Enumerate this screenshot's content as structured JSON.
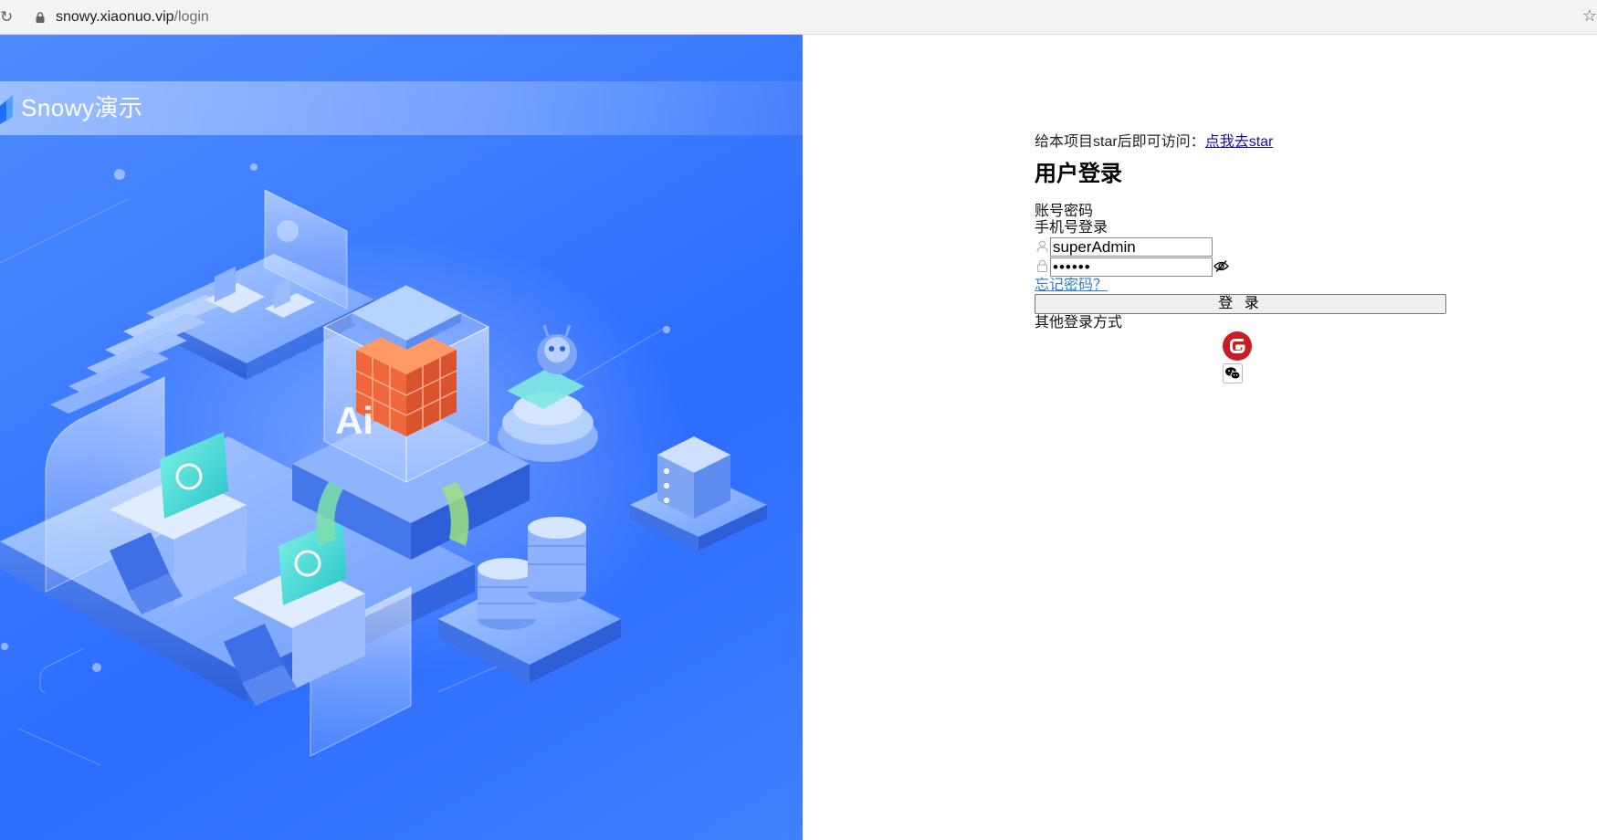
{
  "browser": {
    "url_host": "snowy.xiaonuo.vip",
    "url_path": "/login",
    "reload_icon": "reload-icon",
    "lock_icon": "lock-icon",
    "bookmark_icon": "star-icon"
  },
  "hero": {
    "brand_name": "Snowy演示",
    "illustration_overlay_text": "Ai",
    "background_color": "#3b7bff"
  },
  "login": {
    "notice_text": "给本项目star后即可访问：",
    "notice_link": "点我去star",
    "title": "用户登录",
    "tabs": [
      {
        "label": "账号密码"
      },
      {
        "label": "手机号登录"
      }
    ],
    "username_value": "superAdmin",
    "password_value": "••••••",
    "forgot_password": "忘记密码？",
    "submit_label": "登 录",
    "other_methods_label": "其他登录方式",
    "other_methods": [
      {
        "name": "gitee",
        "icon": "gitee-icon",
        "color": "#c71d23"
      },
      {
        "name": "wechat",
        "icon": "wechat-icon",
        "color": "#000000"
      }
    ],
    "link_color": "#2f7fd2"
  }
}
